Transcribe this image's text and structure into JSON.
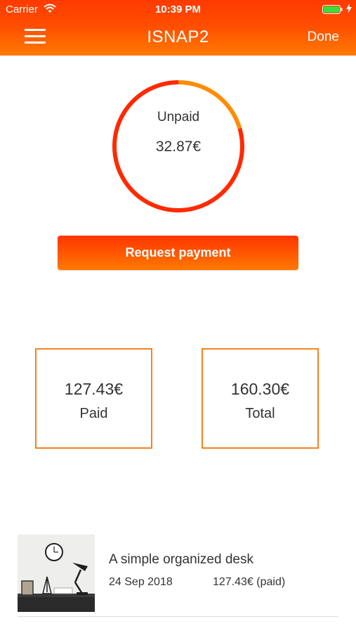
{
  "status_bar": {
    "carrier": "Carrier",
    "time": "10:39 PM",
    "wifi_icon": "wifi-icon",
    "battery_icon": "battery-icon",
    "charge_icon": "bolt-icon"
  },
  "nav": {
    "title": "ISNAP2",
    "menu_icon": "hamburger-icon",
    "done_label": "Done"
  },
  "summary": {
    "ring_label": "Unpaid",
    "unpaid_amount": "32.87€",
    "unpaid_fraction": 0.205
  },
  "actions": {
    "request_payment_label": "Request payment"
  },
  "stats": {
    "paid_value": "127.43€",
    "paid_label": "Paid",
    "total_value": "160.30€",
    "total_label": "Total"
  },
  "items": [
    {
      "title": "A simple organized desk",
      "date": "24 Sep 2018",
      "amount": "127.43€ (paid)"
    }
  ],
  "colors": {
    "header_top": "#ff3a00",
    "header_bottom": "#ff7a00",
    "ring_paid": "#ff2a00",
    "ring_unpaid": "#ff8c00",
    "box_border": "#f5821f"
  }
}
